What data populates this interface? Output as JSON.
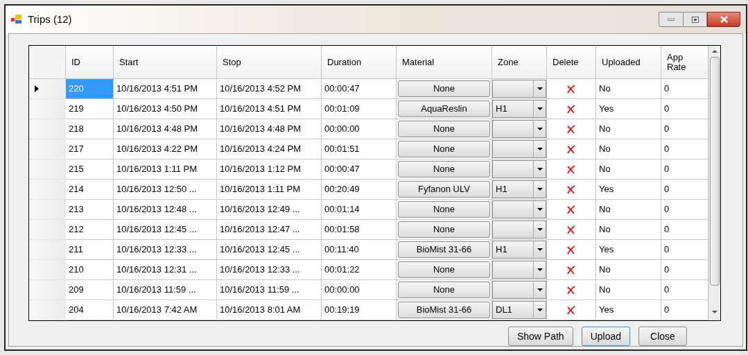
{
  "window": {
    "title": "Trips (12)"
  },
  "table": {
    "columns": [
      "ID",
      "Start",
      "Stop",
      "Duration",
      "Material",
      "Zone",
      "Delete",
      "Uploaded",
      "App Rate"
    ],
    "rows": [
      {
        "selected": true,
        "id": "220",
        "start": "10/16/2013 4:51 PM",
        "stop": "10/16/2013 4:52 PM",
        "duration": "00:00:47",
        "material": "None",
        "uploaded": "No",
        "app_rate": "0"
      },
      {
        "selected": false,
        "id": "219",
        "start": "10/16/2013 4:50 PM",
        "stop": "10/16/2013 4:51 PM",
        "duration": "00:01:09",
        "material": "AquaReslin",
        "zone": "H1",
        "uploaded": "Yes",
        "app_rate": "0"
      },
      {
        "selected": false,
        "id": "218",
        "start": "10/16/2013 4:48 PM",
        "stop": "10/16/2013 4:48 PM",
        "duration": "00:00:00",
        "material": "None",
        "uploaded": "No",
        "app_rate": "0"
      },
      {
        "selected": false,
        "id": "217",
        "start": "10/16/2013 4:22 PM",
        "stop": "10/16/2013 4:24 PM",
        "duration": "00:01:51",
        "material": "None",
        "uploaded": "No",
        "app_rate": "0"
      },
      {
        "selected": false,
        "id": "215",
        "start": "10/16/2013 1:11 PM",
        "stop": "10/16/2013 1:12 PM",
        "duration": "00:00:47",
        "material": "None",
        "uploaded": "No",
        "app_rate": "0"
      },
      {
        "selected": false,
        "id": "214",
        "start": "10/16/2013 12:50 ...",
        "stop": "10/16/2013 1:11 PM",
        "duration": "00:20:49",
        "material": "Fyfanon ULV",
        "zone": "H1",
        "uploaded": "Yes",
        "app_rate": "0"
      },
      {
        "selected": false,
        "id": "213",
        "start": "10/16/2013 12:48 ...",
        "stop": "10/16/2013 12:49 ...",
        "duration": "00:01:14",
        "material": "None",
        "uploaded": "No",
        "app_rate": "0"
      },
      {
        "selected": false,
        "id": "212",
        "start": "10/16/2013 12:45 ...",
        "stop": "10/16/2013 12:47 ...",
        "duration": "00:01:58",
        "material": "None",
        "uploaded": "No",
        "app_rate": "0"
      },
      {
        "selected": false,
        "id": "211",
        "start": "10/16/2013 12:33 ...",
        "stop": "10/16/2013 12:45 ...",
        "duration": "00:11:40",
        "material": "BioMist 31-66",
        "zone": "H1",
        "uploaded": "Yes",
        "app_rate": "0"
      },
      {
        "selected": false,
        "id": "210",
        "start": "10/16/2013 12:31 ...",
        "stop": "10/16/2013 12:33 ...",
        "duration": "00:01:22",
        "material": "None",
        "uploaded": "No",
        "app_rate": "0"
      },
      {
        "selected": false,
        "id": "209",
        "start": "10/16/2013 11:59 ...",
        "stop": "10/16/2013 11:59 ...",
        "duration": "00:00:00",
        "material": "None",
        "uploaded": "No",
        "app_rate": "0"
      },
      {
        "selected": false,
        "id": "204",
        "start": "10/16/2013 7:42 AM",
        "stop": "10/16/2013 8:01 AM",
        "duration": "00:19:19",
        "material": "BioMist 31-66",
        "zone": "DL1",
        "uploaded": "Yes",
        "app_rate": "0"
      }
    ]
  },
  "buttons": [
    "Show Path",
    "Upload",
    "Close"
  ]
}
